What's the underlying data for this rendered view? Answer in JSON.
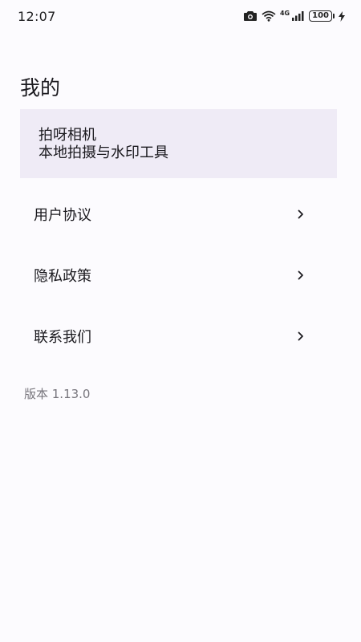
{
  "status_bar": {
    "time": "12:07",
    "network": "4G",
    "battery": "100"
  },
  "page": {
    "title": "我的"
  },
  "app_card": {
    "name": "拍呀相机",
    "tagline": "本地拍摄与水印工具"
  },
  "menu": {
    "items": [
      {
        "label": "用户协议",
        "icon": "chevron-right-icon"
      },
      {
        "label": "隐私政策",
        "icon": "chevron-right-icon"
      },
      {
        "label": "联系我们",
        "icon": "chevron-right-icon"
      }
    ]
  },
  "version": "版本 1.13.0",
  "colors": {
    "background": "#fcfbfe",
    "card": "#efebf6",
    "text": "#1b1a1f",
    "muted": "#77757c"
  }
}
